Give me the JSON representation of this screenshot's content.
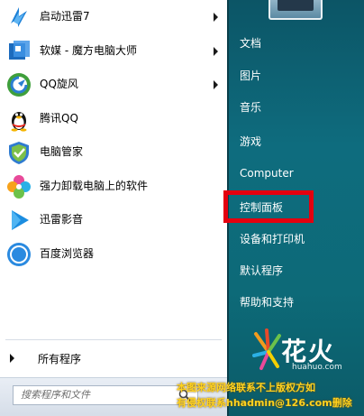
{
  "programs": [
    {
      "label": "启动迅雷7",
      "icon": "xunlei-icon",
      "has_arrow": true
    },
    {
      "label": "软媒 - 魔方电脑大师",
      "icon": "mofang-icon",
      "has_arrow": true
    },
    {
      "label": "QQ旋风",
      "icon": "qqxuanfeng-icon",
      "has_arrow": true
    },
    {
      "label": "腾讯QQ",
      "icon": "qq-penguin-icon",
      "has_arrow": false
    },
    {
      "label": "电脑管家",
      "icon": "shield-icon",
      "has_arrow": false
    },
    {
      "label": "强力卸载电脑上的软件",
      "icon": "uninstall-icon",
      "has_arrow": false
    },
    {
      "label": "迅雷影音",
      "icon": "play-icon",
      "has_arrow": false
    },
    {
      "label": "百度浏览器",
      "icon": "baidu-browser-icon",
      "has_arrow": false
    }
  ],
  "all_programs": "所有程序",
  "search_placeholder": "搜索程序和文件",
  "right_links": [
    "文档",
    "图片",
    "音乐",
    "游戏",
    "Computer",
    "控制面板",
    "设备和打印机",
    "默认程序",
    "帮助和支持"
  ],
  "highlighted_item": "控制面板",
  "logo": {
    "text": "花火",
    "sub": "huahuo.com"
  },
  "watermark": [
    "本图来源网络联系不上版权方如",
    "有侵权联系hhadmin@126.com删除"
  ],
  "colors": {
    "right_panel": "#0e6c7e",
    "highlight_border": "#e4000f",
    "watermark": "#ffd21f"
  }
}
